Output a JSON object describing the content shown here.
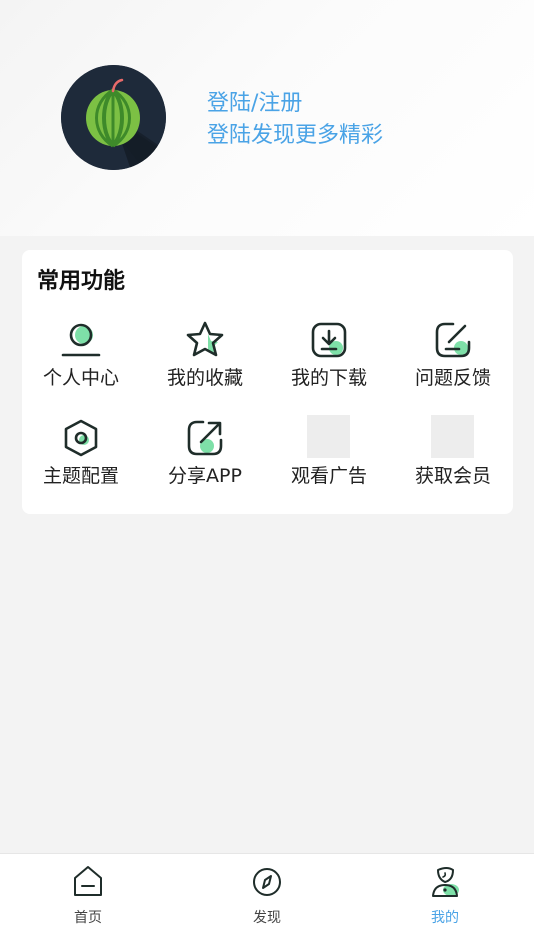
{
  "header": {
    "login_title": "登陆/注册",
    "login_subtitle": "登陆发现更多精彩",
    "avatar_icon": "watermelon-icon"
  },
  "features": {
    "title": "常用功能",
    "items": [
      {
        "label": "个人中心",
        "icon": "user-icon"
      },
      {
        "label": "我的收藏",
        "icon": "star-icon"
      },
      {
        "label": "我的下载",
        "icon": "download-icon"
      },
      {
        "label": "问题反馈",
        "icon": "edit-icon"
      },
      {
        "label": "主题配置",
        "icon": "hexagon-settings-icon"
      },
      {
        "label": "分享APP",
        "icon": "share-icon"
      },
      {
        "label": "观看广告",
        "icon": "image-placeholder"
      },
      {
        "label": "获取会员",
        "icon": "image-placeholder"
      }
    ]
  },
  "tabbar": {
    "tabs": [
      {
        "label": "首页",
        "icon": "home-icon",
        "active": false
      },
      {
        "label": "发现",
        "icon": "compass-icon",
        "active": false
      },
      {
        "label": "我的",
        "icon": "profile-icon",
        "active": true
      }
    ]
  },
  "colors": {
    "accent": "#4aa3e6",
    "icon_stroke": "#1f2d2a",
    "icon_highlight": "#7ee0a8"
  }
}
